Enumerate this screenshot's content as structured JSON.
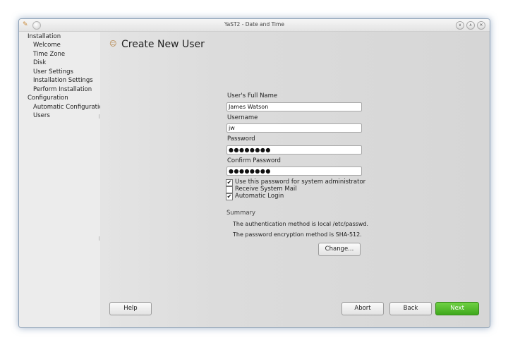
{
  "window": {
    "title": "YaST2 - Date and Time"
  },
  "sidebar": {
    "items": [
      {
        "label": "Installation"
      },
      {
        "label": "Welcome"
      },
      {
        "label": "Time Zone"
      },
      {
        "label": "Disk"
      },
      {
        "label": "User Settings"
      },
      {
        "label": "Installation Settings"
      },
      {
        "label": "Perform Installation"
      },
      {
        "label": "Configuration"
      },
      {
        "label": "Automatic Configuration"
      },
      {
        "label": "Users"
      }
    ]
  },
  "main": {
    "heading": "Create New User",
    "full_name": {
      "label": "User's Full Name",
      "value": "James Watson"
    },
    "username": {
      "label": "Username",
      "value": "jw"
    },
    "password": {
      "label": "Password",
      "value": "●●●●●●●●"
    },
    "confirm_password": {
      "label": "Confirm Password",
      "value": "●●●●●●●●"
    },
    "checkboxes": [
      {
        "label": "Use this password for system administrator",
        "checked": true,
        "mark": "✔"
      },
      {
        "label": "Receive System Mail",
        "checked": false,
        "mark": ""
      },
      {
        "label": "Automatic Login",
        "checked": true,
        "mark": "✔"
      }
    ],
    "summary": {
      "title": "Summary",
      "lines": [
        "The authentication method is local /etc/passwd.",
        "The password encryption method is SHA-512."
      ],
      "change_label": "Change..."
    }
  },
  "buttons": {
    "help": "Help",
    "abort": "Abort",
    "back": "Back",
    "next": "Next"
  },
  "colors": {
    "next_button": "#4fb82a"
  }
}
